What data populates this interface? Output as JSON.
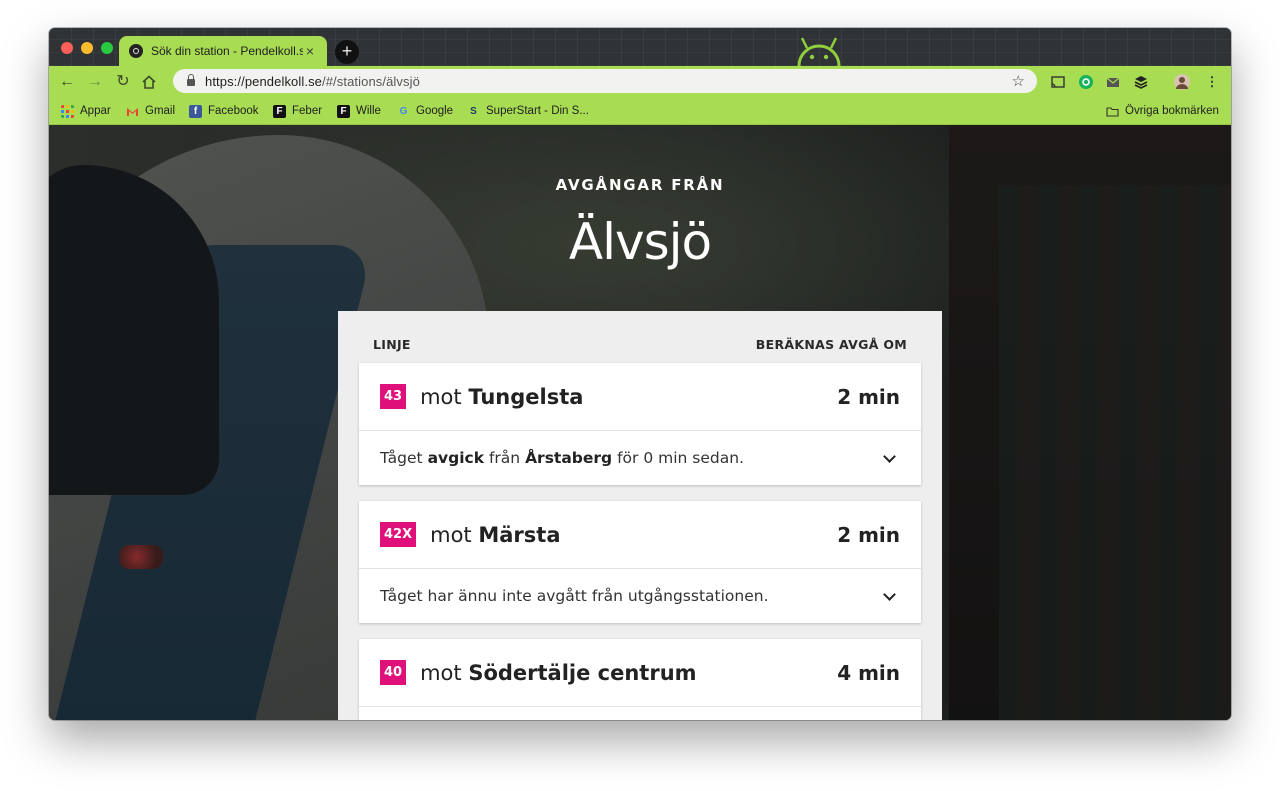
{
  "browser": {
    "tab_title": "Sök din station - Pendelkoll.se",
    "tab_close": "×",
    "new_tab": "+",
    "url_host": "https://pendelkoll.se",
    "url_path": "/#/stations/älvsjö",
    "bookmarks": [
      {
        "label": "Appar",
        "icon": "apps-grid-icon"
      },
      {
        "label": "Gmail",
        "icon": "gmail-icon"
      },
      {
        "label": "Facebook",
        "icon": "facebook-icon"
      },
      {
        "label": "Feber",
        "icon": "feber-icon"
      },
      {
        "label": "Wille",
        "icon": "wille-icon"
      },
      {
        "label": "Google",
        "icon": "google-icon"
      },
      {
        "label": "SuperStart - Din S...",
        "icon": "superstart-icon"
      }
    ],
    "other_bookmarks": "Övriga bokmärken"
  },
  "page": {
    "kicker": "AVGÅNGAR FRÅN",
    "station": "Älvsjö",
    "header_line": "LINJE",
    "header_departs": "BERÄKNAS AVGÅ OM"
  },
  "departures": [
    {
      "line": "43",
      "prefix": "mot",
      "destination": "Tungelsta",
      "eta": "2 min",
      "detail_a": "Tåget",
      "detail_b": "avgick",
      "detail_c": "från",
      "detail_d": "Årstaberg",
      "detail_e": "för 0 min sedan."
    },
    {
      "line": "42X",
      "prefix": "mot",
      "destination": "Märsta",
      "eta": "2 min",
      "detail": "Tåget har ännu inte avgått från utgångsstationen."
    },
    {
      "line": "40",
      "prefix": "mot",
      "destination": "Södertälje centrum",
      "eta": "4 min"
    }
  ],
  "colors": {
    "chrome_theme": "#a8dc52",
    "line_badge": "#e0107a"
  }
}
